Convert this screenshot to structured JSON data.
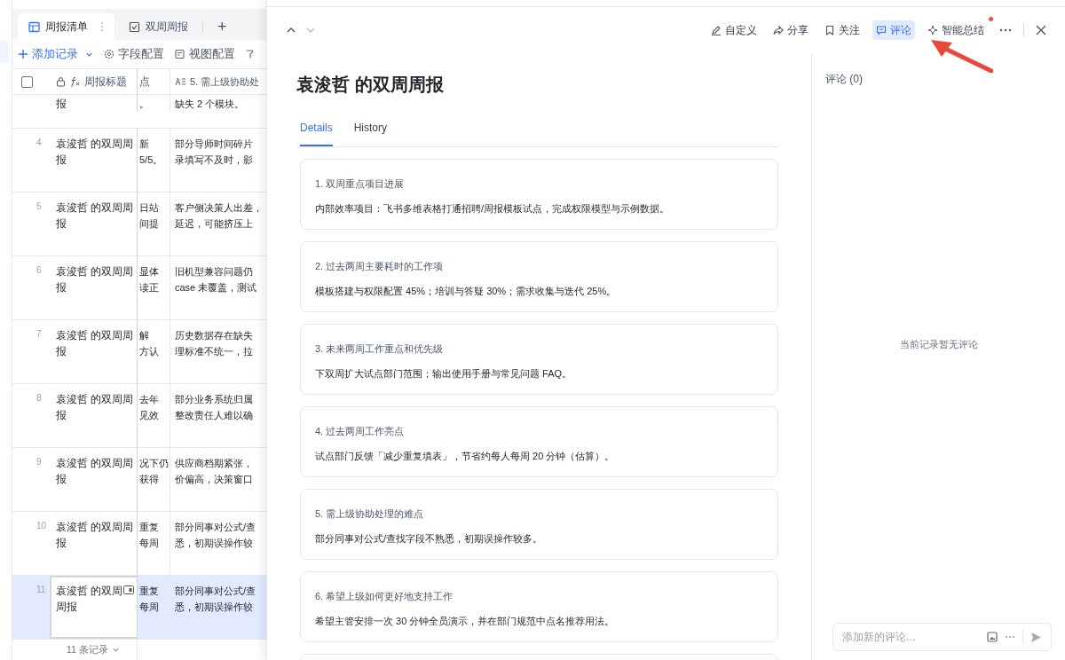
{
  "left_tabs": [
    {
      "label": "周报清单",
      "kind": "table",
      "selected": true
    },
    {
      "label": "双周周报",
      "kind": "form",
      "selected": false
    }
  ],
  "add_tab": "+",
  "toolbar": {
    "add_record": "添加记录",
    "field_config": "字段配置",
    "view_config": "视图配置"
  },
  "table": {
    "select_all": {
      "checked": false
    },
    "columns": [
      "周报标题",
      "点",
      "5. 需上级协助处"
    ],
    "rows": [
      {
        "number": "",
        "title": "报",
        "column_3": [
          "。"
        ],
        "column_5": [
          "缺失 2 个模块。"
        ],
        "selected": false
      },
      {
        "number": "4",
        "title": "袁浚哲 的双周周报",
        "column_3": [
          "新",
          "5/5。"
        ],
        "column_5": [
          "部分导师时间碎片",
          "录填写不及时，影"
        ],
        "selected": false
      },
      {
        "number": "5",
        "title": "袁浚哲 的双周周报",
        "column_3": [
          "日站",
          "间提"
        ],
        "column_5": [
          "客户侧决策人出差，",
          "延迟，可能挤压上"
        ],
        "selected": false
      },
      {
        "number": "6",
        "title": "袁浚哲 的双周周报",
        "column_3": [
          "显体",
          "读正"
        ],
        "column_5": [
          "旧机型兼容问题仍",
          "case 未覆盖，测试"
        ],
        "selected": false
      },
      {
        "number": "7",
        "title": "袁浚哲 的双周周报",
        "column_3": [
          "解",
          "方认"
        ],
        "column_5": [
          "历史数据存在缺失",
          "理标准不统一，拉"
        ],
        "selected": false
      },
      {
        "number": "8",
        "title": "袁浚哲 的双周周报",
        "column_3": [
          "去年",
          "见效"
        ],
        "column_5": [
          "部分业务系统归属",
          "整改责任人难以确"
        ],
        "selected": false
      },
      {
        "number": "9",
        "title": "袁浚哲 的双周周报",
        "column_3": [
          "况下仍",
          "获得"
        ],
        "column_5": [
          "供应商档期紧张，",
          "价偏高，决策窗口"
        ],
        "selected": false
      },
      {
        "number": "10",
        "title": "袁浚哲 的双周周报",
        "column_3": [
          "重复",
          "每周"
        ],
        "column_5": [
          "部分同事对公式/查",
          "悉，初期误操作较"
        ],
        "selected": false
      },
      {
        "number": "11",
        "title": "袁浚哲 的双周周报",
        "column_3": [
          "重复",
          "每周"
        ],
        "column_5": [
          "部分同事对公式/查",
          "悉，初期误操作较"
        ],
        "selected": true
      }
    ],
    "footer": "11 条记录"
  },
  "detail": {
    "actions": [
      {
        "label": "自定义",
        "kind": "edit",
        "selected": false,
        "dot": false
      },
      {
        "label": "分享",
        "kind": "share",
        "selected": false,
        "dot": false
      },
      {
        "label": "关注",
        "kind": "follow",
        "selected": false,
        "dot": false
      },
      {
        "label": "评论",
        "kind": "comment",
        "selected": true,
        "dot": false
      },
      {
        "label": "智能总结",
        "kind": "summary",
        "selected": false,
        "dot": true
      }
    ],
    "title": "袁浚哲 的双周周报",
    "tabs": [
      {
        "label": "Details",
        "selected": true
      },
      {
        "label": "History",
        "selected": false
      }
    ],
    "sections": [
      {
        "heading": "1. 双周重点项目进展",
        "body": "内部效率项目：飞书多维表格打通招聘/周报模板试点，完成权限模型与示例数据。"
      },
      {
        "heading": "2. 过去两周主要耗时的工作项",
        "body": "模板搭建与权限配置 45%；培训与答疑 30%；需求收集与迭代 25%。"
      },
      {
        "heading": "3. 未来两周工作重点和优先级",
        "body": "下双周扩大试点部门范围；输出使用手册与常见问题 FAQ。"
      },
      {
        "heading": "4. 过去两周工作亮点",
        "body": "试点部门反馈「减少重复填表」，节省约每人每周 20 分钟（估算）。"
      },
      {
        "heading": "5. 需上级协助处理的难点",
        "body": "部分同事对公式/查找字段不熟悉，初期误操作较多。"
      },
      {
        "heading": "6. 希望上级如何更好地支持工作",
        "body": "希望主管安排一次 30 分钟全员演示，并在部门规范中点名推荐用法。"
      }
    ]
  },
  "comments": {
    "title": "评论 (0)",
    "empty": "当前记录暂无评论",
    "placeholder": "添加新的评论..."
  }
}
